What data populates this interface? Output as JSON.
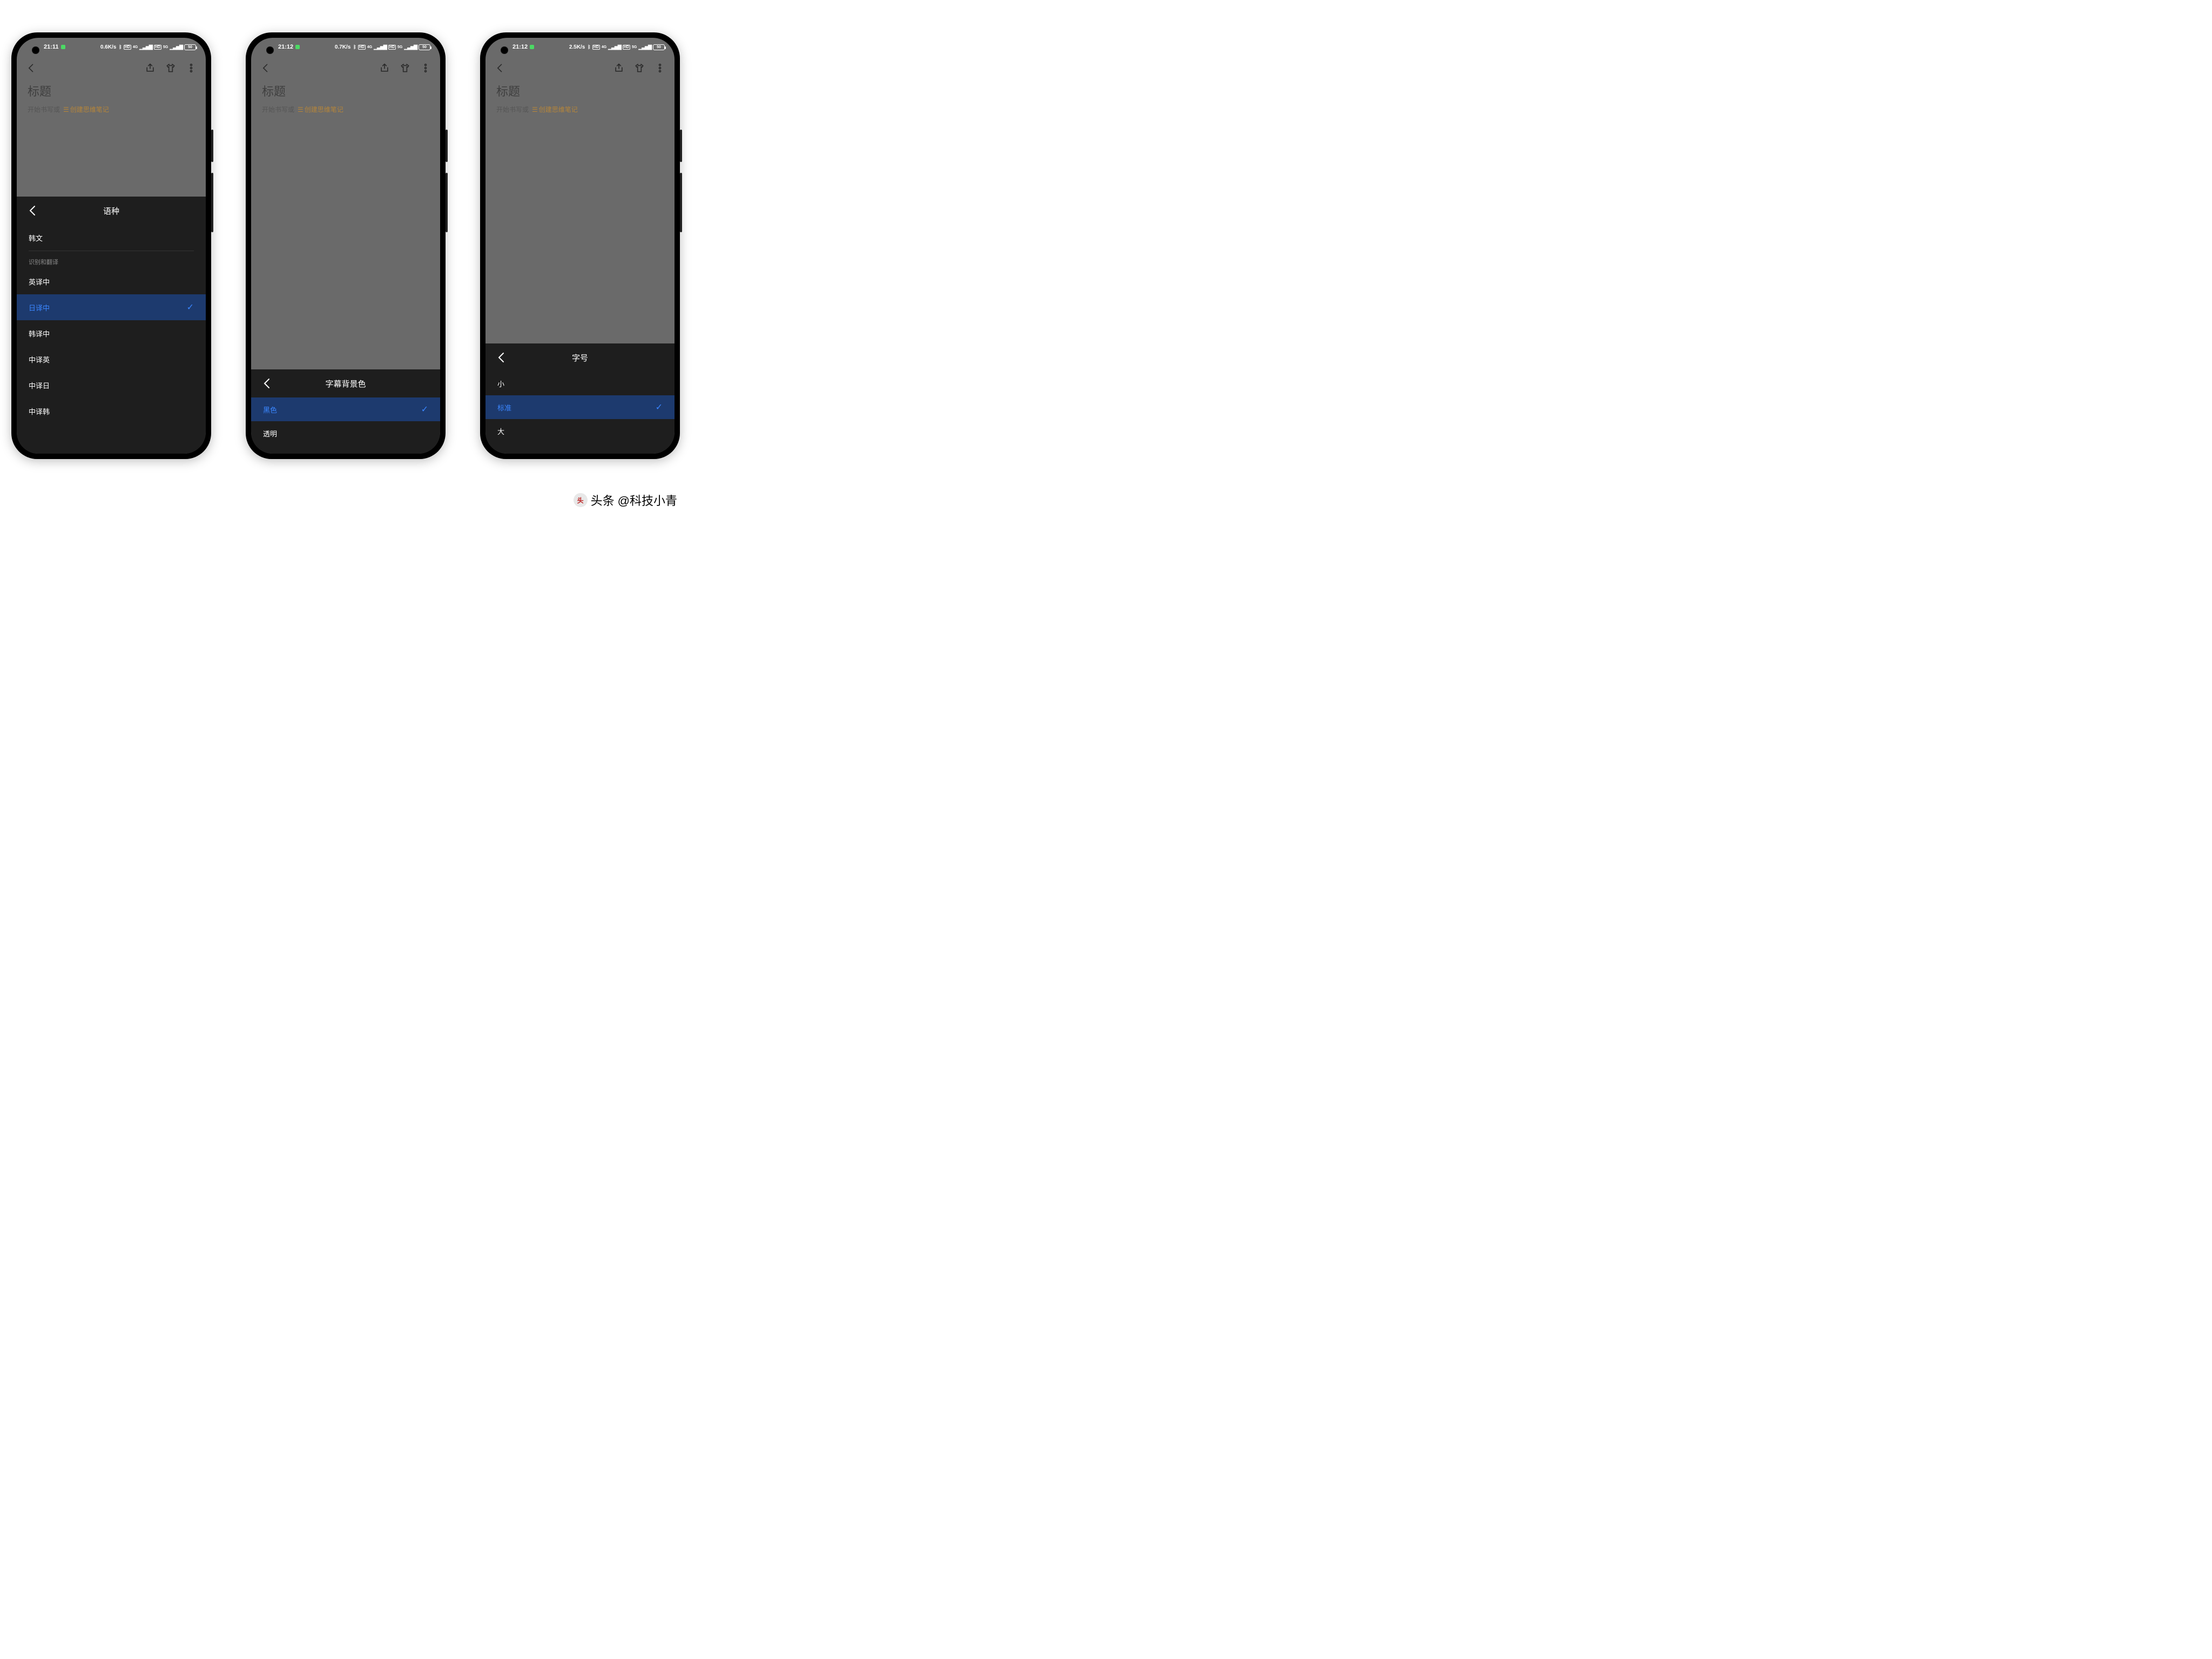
{
  "watermark": {
    "prefix": "头条",
    "author": "@科技小青"
  },
  "phones": [
    {
      "status": {
        "time": "21:11",
        "speed": "0.6K/s",
        "battery": "50"
      },
      "bg": {
        "title": "标题",
        "sub": "开始书写或",
        "tag": "创建思维笔记"
      },
      "sheet": {
        "title": "语种",
        "top_items": [
          {
            "label": "韩文",
            "selected": false
          }
        ],
        "section": "识别和翻译",
        "items": [
          {
            "label": "英译中",
            "selected": false
          },
          {
            "label": "日译中",
            "selected": true
          },
          {
            "label": "韩译中",
            "selected": false
          },
          {
            "label": "中译英",
            "selected": false
          },
          {
            "label": "中译日",
            "selected": false
          },
          {
            "label": "中译韩",
            "selected": false
          }
        ]
      }
    },
    {
      "status": {
        "time": "21:12",
        "speed": "0.7K/s",
        "battery": "50"
      },
      "bg": {
        "title": "标题",
        "sub": "开始书写或",
        "tag": "创建思维笔记"
      },
      "sheet": {
        "title": "字幕背景色",
        "items": [
          {
            "label": "黑色",
            "selected": true
          },
          {
            "label": "透明",
            "selected": false
          }
        ]
      }
    },
    {
      "status": {
        "time": "21:12",
        "speed": "2.5K/s",
        "battery": "50"
      },
      "bg": {
        "title": "标题",
        "sub": "开始书写或",
        "tag": "创建思维笔记"
      },
      "sheet": {
        "title": "字号",
        "items": [
          {
            "label": "小",
            "selected": false
          },
          {
            "label": "标准",
            "selected": true
          },
          {
            "label": "大",
            "selected": false
          }
        ]
      }
    }
  ],
  "icons": {
    "hd": "HD",
    "net": "4G",
    "g5": "5G"
  }
}
